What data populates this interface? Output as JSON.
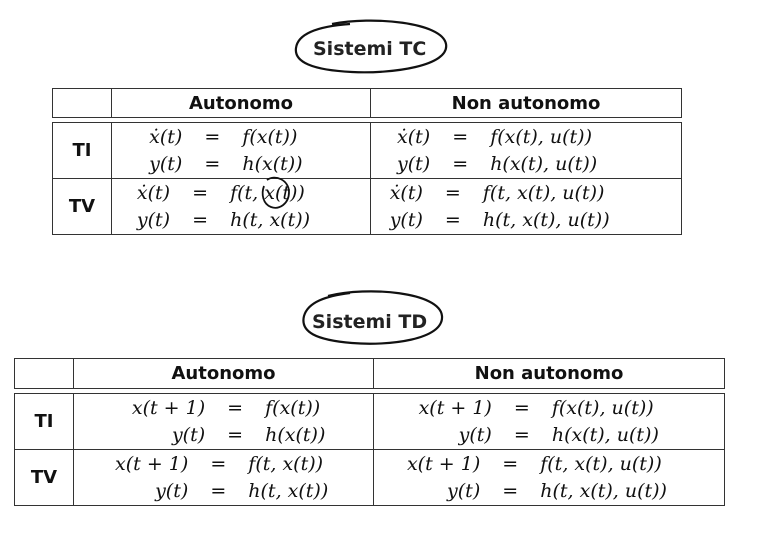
{
  "tc": {
    "title": "Sistemi TC",
    "col_autonomo": "Autonomo",
    "col_non_autonomo": "Non autonomo",
    "rows": [
      {
        "label": "TI",
        "autonomo": [
          {
            "lhs": "ẋ(t)",
            "eq": "=",
            "rhs": "f(x(t))"
          },
          {
            "lhs": "y(t)",
            "eq": "=",
            "rhs": "h(x(t))"
          }
        ],
        "non_autonomo": [
          {
            "lhs": "ẋ(t)",
            "eq": "=",
            "rhs": "f(x(t), u(t))"
          },
          {
            "lhs": "y(t)",
            "eq": "=",
            "rhs": "h(x(t), u(t))"
          }
        ]
      },
      {
        "label": "TV",
        "autonomo": [
          {
            "lhs": "ẋ(t)",
            "eq": "=",
            "rhs": "f(t, x(t))"
          },
          {
            "lhs": "y(t)",
            "eq": "=",
            "rhs": "h(t, x(t))"
          }
        ],
        "non_autonomo": [
          {
            "lhs": "ẋ(t)",
            "eq": "=",
            "rhs": "f(t, x(t), u(t))"
          },
          {
            "lhs": "y(t)",
            "eq": "=",
            "rhs": "h(t, x(t), u(t))"
          }
        ]
      }
    ]
  },
  "td": {
    "title": "Sistemi TD",
    "col_autonomo": "Autonomo",
    "col_non_autonomo": "Non autonomo",
    "rows": [
      {
        "label": "TI",
        "autonomo": [
          {
            "lhs": "x(t + 1)",
            "eq": "=",
            "rhs": "f(x(t))"
          },
          {
            "lhs": "y(t)",
            "eq": "=",
            "rhs": "h(x(t))"
          }
        ],
        "non_autonomo": [
          {
            "lhs": "x(t + 1)",
            "eq": "=",
            "rhs": "f(x(t), u(t))"
          },
          {
            "lhs": "y(t)",
            "eq": "=",
            "rhs": "h(x(t), u(t))"
          }
        ]
      },
      {
        "label": "TV",
        "autonomo": [
          {
            "lhs": "x(t + 1)",
            "eq": "=",
            "rhs": "f(t, x(t))"
          },
          {
            "lhs": "y(t)",
            "eq": "=",
            "rhs": "h(t, x(t))"
          }
        ],
        "non_autonomo": [
          {
            "lhs": "x(t + 1)",
            "eq": "=",
            "rhs": "f(t, x(t), u(t))"
          },
          {
            "lhs": "y(t)",
            "eq": "=",
            "rhs": "h(t, x(t), u(t))"
          }
        ]
      }
    ]
  }
}
